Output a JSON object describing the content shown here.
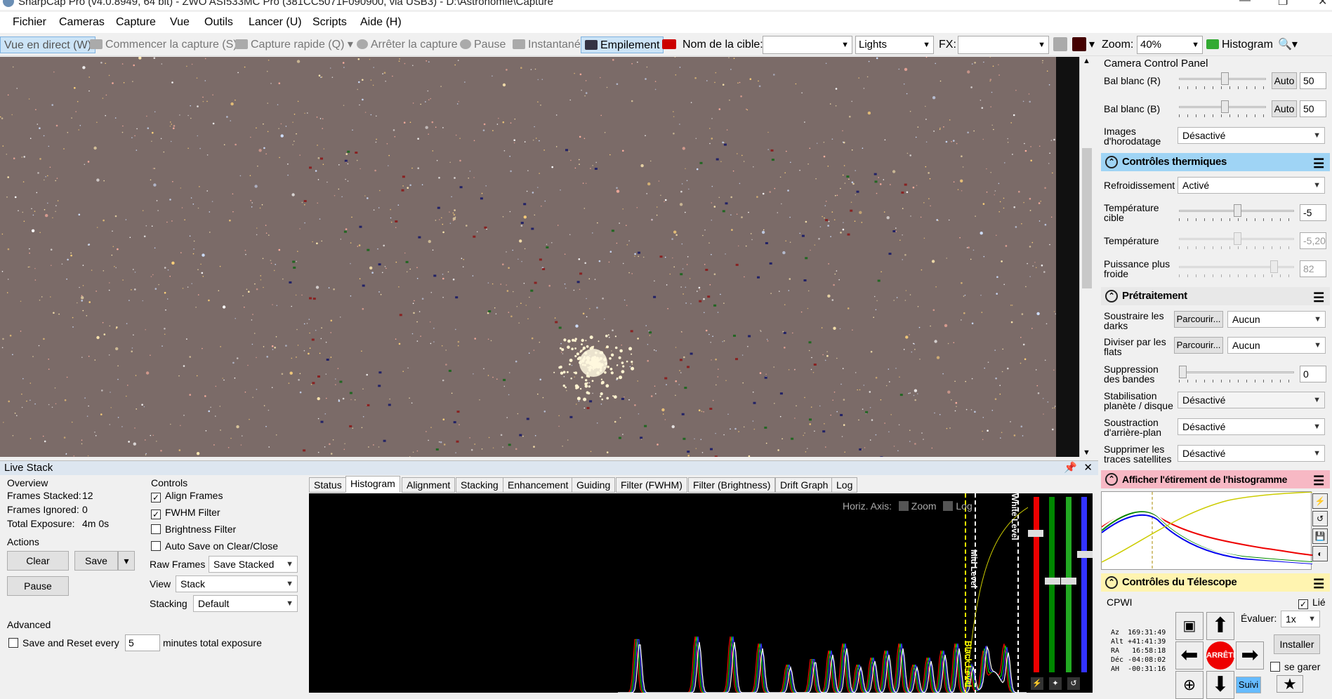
{
  "window": {
    "title": "SharpCap Pro (v4.0.8949, 64 bit) - ZWO ASI533MC Pro (381CC5071F090900, via USB3) - D:\\Astronomie\\Capture"
  },
  "menu": [
    "Fichier",
    "Cameras",
    "Capture",
    "Vue",
    "Outils",
    "Lancer (U)",
    "Scripts",
    "Aide (H)"
  ],
  "toolbar": {
    "live_view": "Vue en direct (W)",
    "start_capture": "Commencer la capture (S)",
    "quick_capture": "Capture rapide (Q)",
    "stop_capture": "Arrêter la capture",
    "pause": "Pause",
    "snapshot": "Instantané",
    "stacking": "Empilement",
    "target_name_label": "Nom de la cible:",
    "frame_type": "Lights",
    "fx_label": "FX:",
    "zoom_label": "Zoom:",
    "zoom_value": "40%",
    "histogram": "Histogram"
  },
  "camera_panel": {
    "title": "Camera Control Panel",
    "wb_red_label": "Bal blanc (R)",
    "wb_red_value": "50",
    "wb_blue_label": "Bal blanc (B)",
    "wb_blue_value": "50",
    "auto_label": "Auto",
    "timestamp_label_1": "Images",
    "timestamp_label_2": "d'horodatage",
    "timestamp_value": "Désactivé",
    "thermal_title": "Contrôles thermiques",
    "cooling_label": "Refroidissement",
    "cooling_value": "Activé",
    "target_temp_label_1": "Température",
    "target_temp_label_2": "cible",
    "target_temp_value": "-5",
    "temp_label": "Température",
    "temp_value": "-5,20",
    "cooler_power_label_1": "Puissance plus",
    "cooler_power_label_2": "froide",
    "cooler_power_value": "82",
    "preproc_title": "Prétraitement",
    "darks_label_1": "Soustraire les",
    "darks_label_2": "darks",
    "browse": "Parcourir...",
    "darks_value": "Aucun",
    "flats_label_1": "Diviser par les",
    "flats_label_2": "flats",
    "flats_value": "Aucun",
    "banding_label_1": "Suppression",
    "banding_label_2": "des bandes",
    "banding_value": "0",
    "planet_label_1": "Stabilisation",
    "planet_label_2": "planète / disque",
    "planet_value": "Désactivé",
    "bg_label_1": "Soustraction",
    "bg_label_2": "d'arrière-plan",
    "bg_value": "Désactivé",
    "sat_label_1": "Supprimer les",
    "sat_label_2": "traces satellites",
    "sat_value": "Désactivé",
    "stretch_title": "Afficher l'étirement de l'histogramme",
    "telescope_title": "Contrôles du Télescope",
    "mount_name": "CPWI",
    "linked": "Lié",
    "rate_label": "Évaluer:",
    "rate_value": "1x",
    "install": "Installer",
    "park": "se garer",
    "tracking": "Suivi",
    "stop": "ARRÊTE",
    "readout": "Az  169:31:49\nAlt +41:41:39\nRA   16:58:18\nDéc -04:08:02\nAH  -00:31:16"
  },
  "live_stack": {
    "title": "Live Stack",
    "overview": "Overview",
    "frames_stacked_label": "Frames Stacked:",
    "frames_stacked": "12",
    "frames_ignored_label": "Frames Ignored:",
    "frames_ignored": "0",
    "total_exposure_label": "Total Exposure:",
    "total_exposure": "4m 0s",
    "actions": "Actions",
    "clear": "Clear",
    "save": "Save",
    "pause": "Pause",
    "advanced": "Advanced",
    "save_reset_label": "Save and Reset every",
    "save_reset_value": "5",
    "save_reset_suffix": "minutes total exposure",
    "controls": "Controls",
    "align_frames": "Align Frames",
    "fwhm_filter": "FWHM Filter",
    "brightness_filter": "Brightness Filter",
    "auto_save": "Auto Save on Clear/Close",
    "raw_frames_label": "Raw Frames",
    "raw_frames_value": "Save Stacked",
    "view_label": "View",
    "view_value": "Stack",
    "stacking_label": "Stacking",
    "stacking_value": "Default",
    "tabs": [
      "Status",
      "Histogram",
      "Alignment",
      "Stacking",
      "Enhancement",
      "Guiding",
      "Filter (FWHM)",
      "Filter (Brightness)",
      "Drift Graph",
      "Log"
    ],
    "horiz_axis": "Horiz. Axis:",
    "zoom": "Zoom",
    "log": "Log",
    "white_level": "White Level",
    "mid_level": "Mid Level",
    "black_level": "Black Level"
  },
  "colors": {
    "accent": "#cce4f7",
    "thermal": "#9fd4f5",
    "stretch": "#f7b8c4",
    "telescope": "#fff4b0"
  }
}
